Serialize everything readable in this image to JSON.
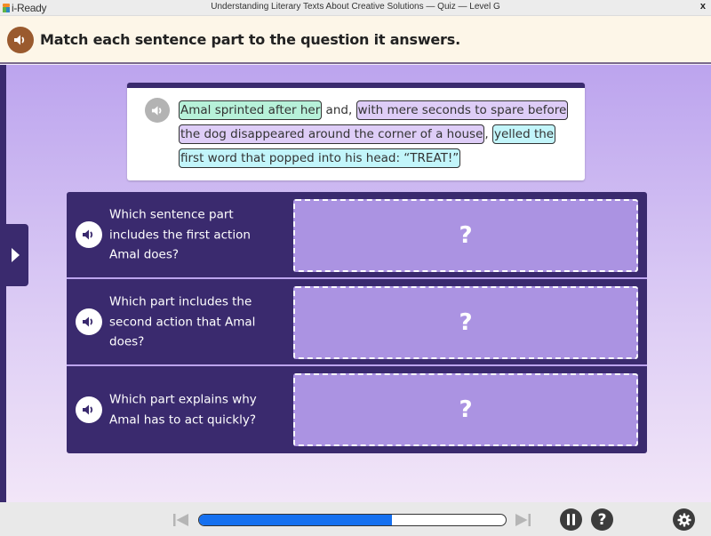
{
  "window": {
    "app_name": "i-Ready",
    "title": "Understanding Literary Texts About Creative Solutions — Quiz — Level G",
    "close_label": "x"
  },
  "instruction": {
    "audio_icon": "speaker-icon",
    "text": "Match each sentence part to the question it answers."
  },
  "passage": {
    "audio_icon": "speaker-icon",
    "chunks": [
      {
        "text": "Amal sprinted after her",
        "style": "green",
        "selectable": true
      },
      {
        "text": " and, ",
        "style": "plain",
        "selectable": false
      },
      {
        "text": "with mere seconds to spare before the dog disappeared around the corner of a house",
        "style": "purple",
        "selectable": true
      },
      {
        "text": ", ",
        "style": "plain",
        "selectable": false
      },
      {
        "text": "yelled the first word that popped into his head: “TREAT!”",
        "style": "cyan",
        "selectable": true
      }
    ]
  },
  "questions": [
    {
      "text": "Which sentence part includes the first action Amal does?",
      "dropzone_placeholder": "?"
    },
    {
      "text": "Which part includes the second action that Amal does?",
      "dropzone_placeholder": "?"
    },
    {
      "text": "Which part explains why Amal has to act quickly?",
      "dropzone_placeholder": "?"
    }
  ],
  "bottombar": {
    "progress_percent": 63,
    "help_label": "?",
    "buttons": [
      "skip-back",
      "skip-forward",
      "pause",
      "help",
      "settings"
    ]
  },
  "colors": {
    "accent_dark": "#3a2a6e",
    "dropzone": "#ab93e2",
    "progress": "#1570f0",
    "instruction_audio": "#9a5a2e",
    "chunk_green": "#b7f1d9",
    "chunk_purple": "#decdf7",
    "chunk_cyan": "#c2f5fa"
  }
}
